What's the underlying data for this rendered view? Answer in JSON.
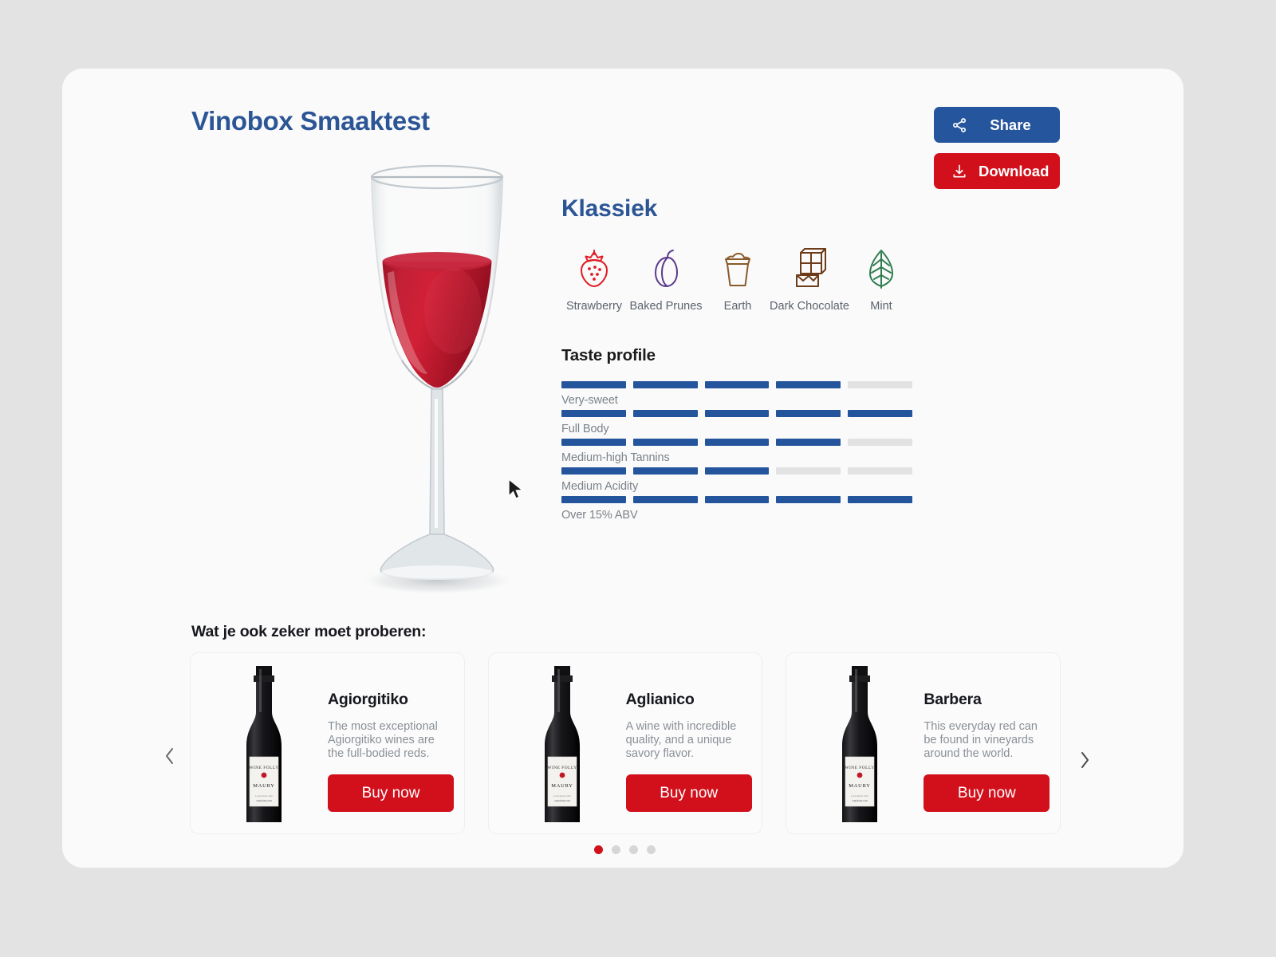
{
  "header": {
    "title": "Vinobox Smaaktest",
    "share_label": "Share",
    "download_label": "Download",
    "share_color": "#25559c",
    "download_color": "#d2101c"
  },
  "result": {
    "variety": "Klassiek",
    "flavors": [
      {
        "label": "Strawberry",
        "icon": "strawberry-icon",
        "color": "#e01b24"
      },
      {
        "label": "Baked Prunes",
        "icon": "plum-icon",
        "color": "#5b3a8e"
      },
      {
        "label": "Earth",
        "icon": "earth-pot-icon",
        "color": "#8a5a2b"
      },
      {
        "label": "Dark Chocolate",
        "icon": "chocolate-bar-icon",
        "color": "#6d3b18"
      },
      {
        "label": "Mint",
        "icon": "mint-leaf-icon",
        "color": "#2e7d4f"
      }
    ],
    "taste_profile_title": "Taste profile",
    "taste_profile": [
      {
        "label": "Very-sweet",
        "value": 4,
        "max": 5
      },
      {
        "label": "Full Body",
        "value": 5,
        "max": 5
      },
      {
        "label": "Medium-high Tannins",
        "value": 4,
        "max": 5
      },
      {
        "label": "Medium Acidity",
        "value": 3,
        "max": 5
      },
      {
        "label": "Over 15% ABV",
        "value": 5,
        "max": 5
      }
    ],
    "bar_on_color": "#24549b",
    "bar_off_color": "#e2e2e2"
  },
  "recommendations": {
    "title": "Wat je ook zeker moet proberen:",
    "buy_label": "Buy now",
    "bottle_label_brand": "WINE FOLLY",
    "bottle_label_name": "MAURY",
    "bottle_label_sub": "winefolly.com",
    "cards": [
      {
        "name": "Agiorgitiko",
        "description": "The most exceptional Agiorgitiko wines are the full-bodied reds.",
        "buy_label": "Buy now"
      },
      {
        "name": "Aglianico",
        "description": "A wine with incredible quality, and a unique savory flavor.",
        "buy_label": "Buy now"
      },
      {
        "name": "Barbera",
        "description": "This everyday red can be found in vineyards around the world.",
        "buy_label": "Buy now"
      }
    ],
    "dots": 4,
    "active_dot": 0,
    "prev_icon": "chevron-left-icon",
    "next_icon": "chevron-right-icon"
  }
}
